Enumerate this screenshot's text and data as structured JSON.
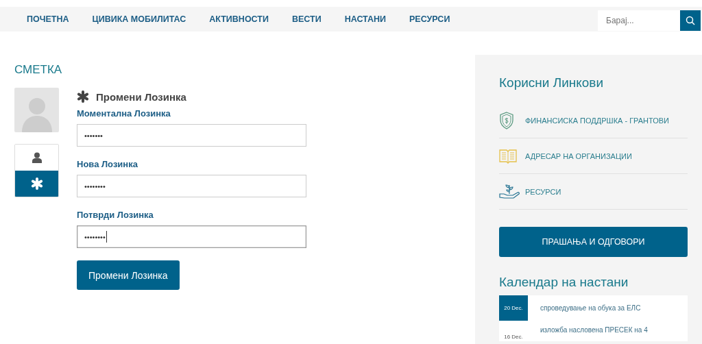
{
  "nav": {
    "items": [
      {
        "label": "ПОЧЕТНА"
      },
      {
        "label": "ЦИВИКА МОБИЛИТАС"
      },
      {
        "label": "АКТИВНОСТИ"
      },
      {
        "label": "ВЕСТИ"
      },
      {
        "label": "НАСТАНИ"
      },
      {
        "label": "РЕСУРСИ"
      }
    ],
    "search": {
      "placeholder": "Барај..."
    }
  },
  "account": {
    "title": "СМЕТКА",
    "tabs": [
      {
        "kind": "profile",
        "selected": false
      },
      {
        "kind": "password",
        "selected": true
      }
    ],
    "form_title": "Промени Лозинка",
    "fields": [
      {
        "label": "Моментална Лозинка",
        "value": "•••••••",
        "focused": false
      },
      {
        "label": "Нова Лозинка",
        "value": "••••••••",
        "focused": false
      },
      {
        "label": "Потврди Лозинка",
        "value": "••••••••",
        "focused": true
      }
    ],
    "submit": "Промени Лозинка"
  },
  "sidebar": {
    "title": "Корисни Линкови",
    "links": [
      {
        "kind": "shield",
        "label": "ФИНАНСИСКА ПОДДРШКА - ГРАНТОВИ"
      },
      {
        "kind": "book",
        "label": "АДРЕСАР НА ОРГАНИЗАЦИИ"
      },
      {
        "kind": "plant",
        "label": "РЕСУРСИ"
      }
    ],
    "faq_button": "ПРАШАЊА И ОДГОВОРИ",
    "calendar_title": "Календар на настани",
    "events": [
      {
        "date": "20 Dec.",
        "title": "спроведување на обука за ЕЛС",
        "highlighted": true
      },
      {
        "date": "16 Dec.",
        "title": "изложба насловена ПРЕСЕК на 4",
        "highlighted": false
      }
    ]
  }
}
